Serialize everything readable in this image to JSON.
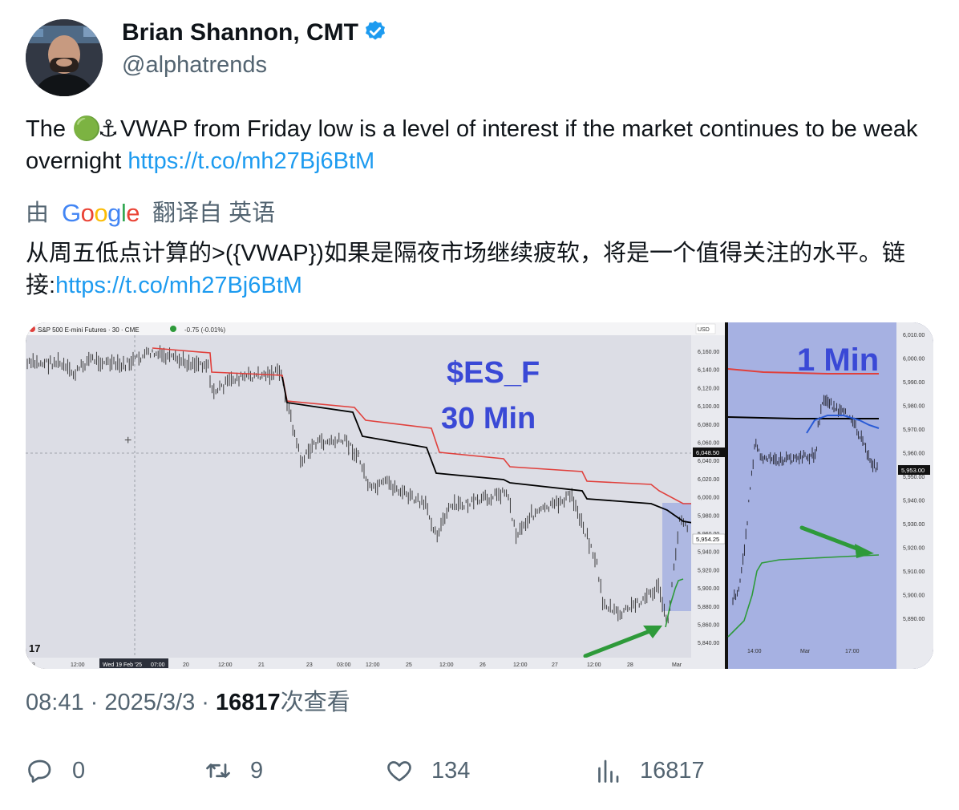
{
  "author": {
    "name": "Brian Shannon, CMT",
    "handle": "@alphatrends"
  },
  "tweet": {
    "text_before": "The ",
    "emoji_circle": "🟢",
    "emoji_anchor": "⚓",
    "text_after": "VWAP from Friday low is a level of interest if the market continues to be weak overnight ",
    "link": "https://t.co/mh27Bj6BtM"
  },
  "translation": {
    "prefix": "由",
    "google": [
      "G",
      "o",
      "o",
      "g",
      "l",
      "e"
    ],
    "suffix": "翻译自 英语",
    "text": "从周五低点计算的>({VWAP})如果是隔夜市场继续疲软，将是一个值得关注的水平。链接:",
    "link": "https://t.co/mh27Bj6BtM"
  },
  "chart_image": {
    "header": "S&P 500 E-mini Futures · 30 · CME",
    "change": "-0.75 (-0.01%)",
    "currency": "USD",
    "title_ticker": "$ES_F",
    "title_interval": "30 Min",
    "inset_title": "1 Min",
    "price_tag_main": "6,048.50",
    "price_tag_low": "5,954.25",
    "inset_price_tag": "5,953.00",
    "main_axis_ticks": [
      "6,160.00",
      "6,140.00",
      "6,120.00",
      "6,100.00",
      "6,080.00",
      "6,060.00",
      "6,040.00",
      "6,020.00",
      "6,000.00",
      "5,980.00",
      "5,960.00",
      "5,940.00",
      "5,920.00",
      "5,900.00",
      "5,880.00",
      "5,860.00",
      "5,840.00"
    ],
    "inset_axis_ticks": [
      "6,010.00",
      "6,000.00",
      "5,990.00",
      "5,980.00",
      "5,970.00",
      "5,960.00",
      "5,950.00",
      "5,940.00",
      "5,930.00",
      "5,920.00",
      "5,910.00",
      "5,900.00",
      "5,890.00"
    ],
    "main_x_labels": [
      "18",
      "12:00",
      "Wed 19 Feb '25",
      "07:00",
      "20",
      "12:00",
      "21",
      "23",
      "03:00",
      "12:00",
      "25",
      "12:00",
      "26",
      "12:00",
      "27",
      "12:00",
      "28",
      "Mar"
    ],
    "inset_x_labels": [
      "14:00",
      "Mar",
      "17:00"
    ],
    "logo": "17"
  },
  "meta": {
    "time": "08:41",
    "date": "2025/3/3",
    "views": "16817",
    "views_label": "次查看",
    "sep": " · "
  },
  "actions": {
    "replies": "0",
    "retweets": "9",
    "likes": "134",
    "views": "16817"
  },
  "colors": {
    "link": "#1d9bf0",
    "muted": "#536471",
    "vwap_red": "#e0403c",
    "vwap_black": "#000000",
    "vwap_green": "#2e9a3a",
    "inset_bg": "#a6b1e2",
    "chart_bg": "#dcdde5",
    "title_blue": "#3a49d6"
  }
}
